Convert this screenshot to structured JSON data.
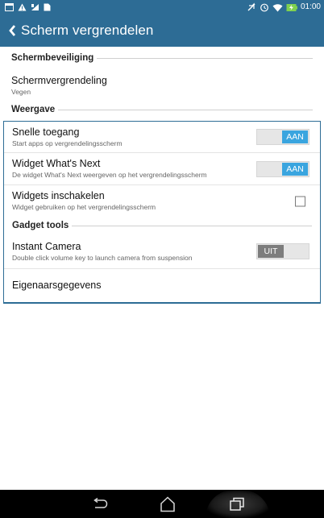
{
  "status_bar": {
    "time": "01:00",
    "left_icons": [
      "screenshot-icon",
      "warning-icon",
      "signal-icon",
      "doc-icon"
    ],
    "right_icons": [
      "no-sound-icon",
      "alarm-icon",
      "wifi-icon",
      "battery-icon"
    ]
  },
  "app_bar": {
    "title": "Scherm vergrendelen",
    "back_icon": "chevron-left-icon"
  },
  "sections": {
    "security": {
      "header": "Schermbeveiliging",
      "item_title": "Schermvergrendeling",
      "item_sub": "Vegen"
    },
    "display": {
      "header": "Weergave",
      "quick_access_title": "Snelle toegang",
      "quick_access_sub": "Start apps op vergrendelingsscherm",
      "quick_access_toggle": "AAN",
      "whats_next_title": "Widget What's Next",
      "whats_next_sub": "De widget What's Next weergeven op het vergrendelingsscherm",
      "whats_next_toggle": "AAN",
      "widgets_title": "Widgets inschakelen",
      "widgets_sub": "Widget gebruiken op het vergrendelingsscherm"
    },
    "gadget": {
      "header": "Gadget tools",
      "camera_title": "Instant Camera",
      "camera_sub": "Double click volume key to launch camera from suspension",
      "camera_toggle": "UIT",
      "owner_title": "Eigenaarsgegevens"
    }
  },
  "colors": {
    "primary": "#2d6c95",
    "toggle_on": "#3aa5df",
    "toggle_off": "#7d7d7d"
  },
  "nav_bar": {
    "icons": [
      "back-nav-icon",
      "home-nav-icon",
      "recents-nav-icon"
    ]
  }
}
